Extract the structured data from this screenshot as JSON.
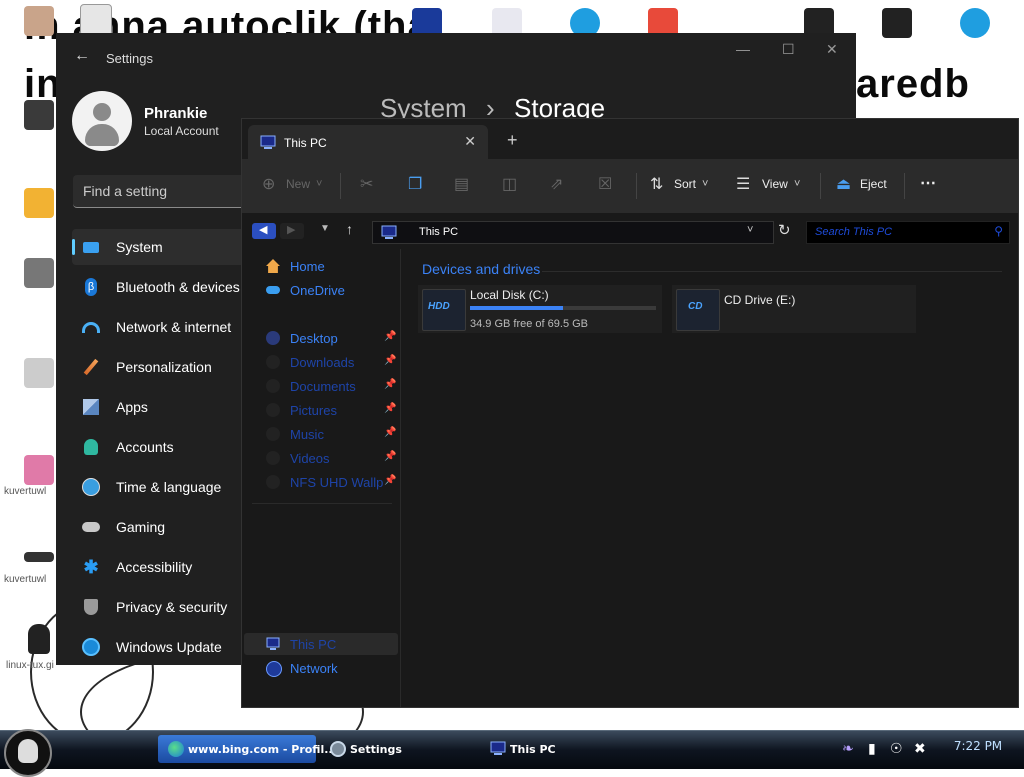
{
  "desktop": {
    "bg_line1": "m    anna autoclik    (tha",
    "bg_line2": "in",
    "bg_line3": "aredb",
    "icon_labels": [
      "kuvertuwl",
      "kuvertuwl",
      "linux-tux.gi"
    ]
  },
  "settings": {
    "window_title": "Settings",
    "user_name": "Phrankie",
    "account_type": "Local Account",
    "search_placeholder": "Find a setting",
    "breadcrumb_parent": "System",
    "breadcrumb_separator": "›",
    "breadcrumb_current": "Storage",
    "nav_items": [
      {
        "label": "System",
        "icon": "monitor-icon",
        "active": true
      },
      {
        "label": "Bluetooth & devices",
        "icon": "bluetooth-icon"
      },
      {
        "label": "Network & internet",
        "icon": "wifi-icon"
      },
      {
        "label": "Personalization",
        "icon": "brush-icon"
      },
      {
        "label": "Apps",
        "icon": "apps-icon"
      },
      {
        "label": "Accounts",
        "icon": "person-icon"
      },
      {
        "label": "Time & language",
        "icon": "globe-clock-icon"
      },
      {
        "label": "Gaming",
        "icon": "gamepad-icon"
      },
      {
        "label": "Accessibility",
        "icon": "accessibility-icon"
      },
      {
        "label": "Privacy & security",
        "icon": "shield-icon"
      },
      {
        "label": "Windows Update",
        "icon": "sync-icon"
      }
    ]
  },
  "explorer": {
    "tab_title": "This PC",
    "address": "This PC",
    "search_placeholder": "Search This PC",
    "commands": {
      "new_label": "New",
      "sort_label": "Sort",
      "view_label": "View",
      "eject_label": "Eject"
    },
    "nav": {
      "home": "Home",
      "onedrive": "OneDrive",
      "quick_access": [
        "Desktop",
        "Downloads",
        "Documents",
        "Pictures",
        "Music",
        "Videos",
        "NFS UHD Wallp"
      ],
      "this_pc": "This PC",
      "network": "Network"
    },
    "group_title": "Devices and drives",
    "drives": [
      {
        "name": "Local Disk (C:)",
        "badge": "HDD",
        "free_text": "34.9 GB free of 69.5 GB",
        "used_fraction": 0.5
      },
      {
        "name": "CD Drive (E:)",
        "badge": "CD"
      }
    ]
  },
  "taskbar": {
    "items": [
      {
        "label": "www.bing.com - Profil...",
        "icon": "edge-icon",
        "active": true
      },
      {
        "label": "Settings",
        "icon": "gear-icon"
      },
      {
        "label": "This PC",
        "icon": "computer-icon"
      }
    ],
    "clock": "7:22 PM"
  },
  "colors": {
    "accent": "#3b82f6",
    "settings_bg": "#202020",
    "explorer_bg": "#191919"
  }
}
